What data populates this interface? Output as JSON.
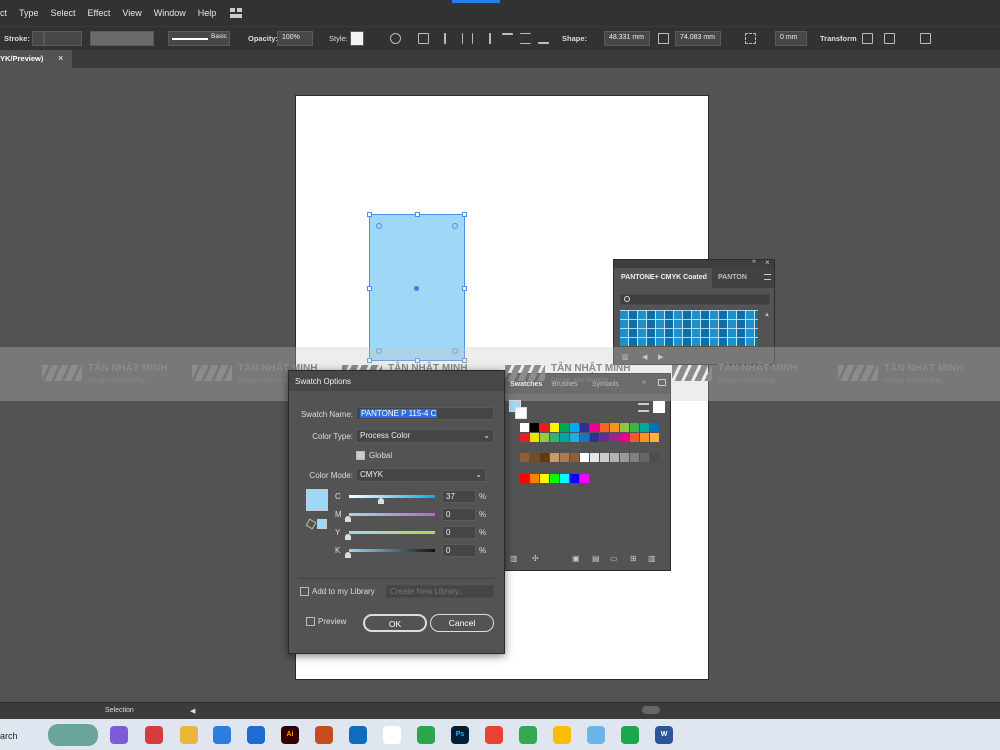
{
  "menubar": {
    "items": [
      "ct",
      "Type",
      "Select",
      "Effect",
      "View",
      "Window",
      "Help"
    ]
  },
  "controlbar": {
    "stroke_label": "Stroke:",
    "brush_label": "Basic",
    "opacity_label": "Opacity:",
    "opacity_value": "100%",
    "style_label": "Style:",
    "shape_label": "Shape:",
    "width_value": "48.331 mm",
    "height_value": "74.083 mm",
    "corner_value": "0 mm",
    "transform_label": "Transform"
  },
  "document": {
    "tab_title": "YK/Preview)",
    "close_glyph": "×"
  },
  "watermark": {
    "name": "TÂN NHẬT MINH",
    "tagline": "Design and Printing"
  },
  "pantone_panel": {
    "active_tab": "PANTONE+ CMYK Coated",
    "second_tab": "PANTON",
    "menu_icon": "menu-icon"
  },
  "swatches_panel": {
    "tabs": [
      "Swatches",
      "Brushes",
      "Symbols"
    ],
    "colors": {
      "row1": [
        "#ffffff",
        "#000000",
        "#ed1c24",
        "#fff200",
        "#00a651",
        "#00aeef",
        "#2e3192",
        "#ec008c",
        "#f26522",
        "#f7941d",
        "#8dc63f",
        "#39b54a",
        "#00a99d",
        "#0072bc"
      ],
      "row2": [
        "#ec1c24",
        "#e6e600",
        "#9bc93c",
        "#2bb673",
        "#00a79d",
        "#27aae1",
        "#1c75bc",
        "#2e3192",
        "#662d91",
        "#92278f",
        "#ed008c",
        "#f15a29",
        "#f7941d",
        "#fbb040"
      ],
      "row3": [
        "#8b5e3c",
        "#754c24",
        "#603913",
        "#c49a6c",
        "#a97c50",
        "#8b5e3c",
        "#fff",
        "#e6e6e6",
        "#ccc",
        "#b3b3b3",
        "#999",
        "#808080",
        "#666",
        "#4d4d4d"
      ],
      "row4": [
        "#ff0000",
        "#ff8000",
        "#ffff00",
        "#00ff00",
        "#00ffff",
        "#0000ff",
        "#ff00ff"
      ]
    }
  },
  "dialog": {
    "title": "Swatch Options",
    "swatch_name_label": "Swatch Name:",
    "swatch_name_value": "PANTONE P 115-4 C",
    "color_type_label": "Color Type:",
    "color_type_value": "Process Color",
    "global_label": "Global",
    "color_mode_label": "Color Mode:",
    "color_mode_value": "CMYK",
    "channels": [
      {
        "name": "C",
        "value": "37",
        "unit": "%"
      },
      {
        "name": "M",
        "value": "0",
        "unit": "%"
      },
      {
        "name": "Y",
        "value": "0",
        "unit": "%"
      },
      {
        "name": "K",
        "value": "0",
        "unit": "%"
      }
    ],
    "library_label": "Add to my Library",
    "library_dropdown": "Create New Library...",
    "preview_label": "Preview",
    "ok_label": "OK",
    "cancel_label": "Cancel",
    "swatch_color": "#9fd7f6"
  },
  "statusbar": {
    "tool": "Selection"
  },
  "taskbar": {
    "search_text": "arch"
  }
}
